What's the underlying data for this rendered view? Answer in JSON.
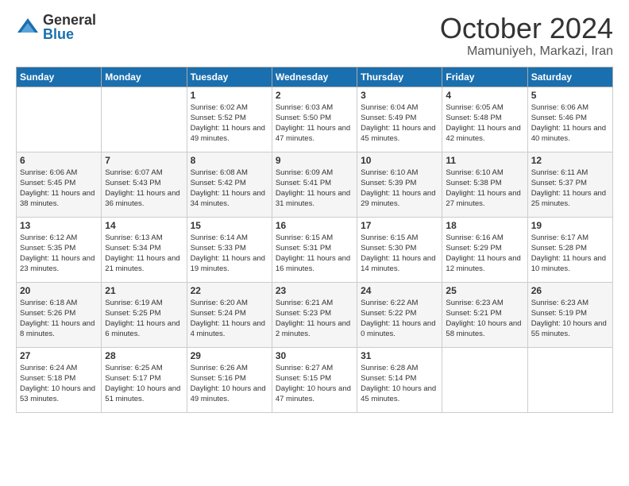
{
  "logo": {
    "general": "General",
    "blue": "Blue"
  },
  "title": {
    "month": "October 2024",
    "location": "Mamuniyeh, Markazi, Iran"
  },
  "headers": [
    "Sunday",
    "Monday",
    "Tuesday",
    "Wednesday",
    "Thursday",
    "Friday",
    "Saturday"
  ],
  "weeks": [
    [
      {
        "day": "",
        "info": ""
      },
      {
        "day": "",
        "info": ""
      },
      {
        "day": "1",
        "sunrise": "6:02 AM",
        "sunset": "5:52 PM",
        "daylight": "11 hours and 49 minutes."
      },
      {
        "day": "2",
        "sunrise": "6:03 AM",
        "sunset": "5:50 PM",
        "daylight": "11 hours and 47 minutes."
      },
      {
        "day": "3",
        "sunrise": "6:04 AM",
        "sunset": "5:49 PM",
        "daylight": "11 hours and 45 minutes."
      },
      {
        "day": "4",
        "sunrise": "6:05 AM",
        "sunset": "5:48 PM",
        "daylight": "11 hours and 42 minutes."
      },
      {
        "day": "5",
        "sunrise": "6:06 AM",
        "sunset": "5:46 PM",
        "daylight": "11 hours and 40 minutes."
      }
    ],
    [
      {
        "day": "6",
        "sunrise": "6:06 AM",
        "sunset": "5:45 PM",
        "daylight": "11 hours and 38 minutes."
      },
      {
        "day": "7",
        "sunrise": "6:07 AM",
        "sunset": "5:43 PM",
        "daylight": "11 hours and 36 minutes."
      },
      {
        "day": "8",
        "sunrise": "6:08 AM",
        "sunset": "5:42 PM",
        "daylight": "11 hours and 34 minutes."
      },
      {
        "day": "9",
        "sunrise": "6:09 AM",
        "sunset": "5:41 PM",
        "daylight": "11 hours and 31 minutes."
      },
      {
        "day": "10",
        "sunrise": "6:10 AM",
        "sunset": "5:39 PM",
        "daylight": "11 hours and 29 minutes."
      },
      {
        "day": "11",
        "sunrise": "6:10 AM",
        "sunset": "5:38 PM",
        "daylight": "11 hours and 27 minutes."
      },
      {
        "day": "12",
        "sunrise": "6:11 AM",
        "sunset": "5:37 PM",
        "daylight": "11 hours and 25 minutes."
      }
    ],
    [
      {
        "day": "13",
        "sunrise": "6:12 AM",
        "sunset": "5:35 PM",
        "daylight": "11 hours and 23 minutes."
      },
      {
        "day": "14",
        "sunrise": "6:13 AM",
        "sunset": "5:34 PM",
        "daylight": "11 hours and 21 minutes."
      },
      {
        "day": "15",
        "sunrise": "6:14 AM",
        "sunset": "5:33 PM",
        "daylight": "11 hours and 19 minutes."
      },
      {
        "day": "16",
        "sunrise": "6:15 AM",
        "sunset": "5:31 PM",
        "daylight": "11 hours and 16 minutes."
      },
      {
        "day": "17",
        "sunrise": "6:15 AM",
        "sunset": "5:30 PM",
        "daylight": "11 hours and 14 minutes."
      },
      {
        "day": "18",
        "sunrise": "6:16 AM",
        "sunset": "5:29 PM",
        "daylight": "11 hours and 12 minutes."
      },
      {
        "day": "19",
        "sunrise": "6:17 AM",
        "sunset": "5:28 PM",
        "daylight": "11 hours and 10 minutes."
      }
    ],
    [
      {
        "day": "20",
        "sunrise": "6:18 AM",
        "sunset": "5:26 PM",
        "daylight": "11 hours and 8 minutes."
      },
      {
        "day": "21",
        "sunrise": "6:19 AM",
        "sunset": "5:25 PM",
        "daylight": "11 hours and 6 minutes."
      },
      {
        "day": "22",
        "sunrise": "6:20 AM",
        "sunset": "5:24 PM",
        "daylight": "11 hours and 4 minutes."
      },
      {
        "day": "23",
        "sunrise": "6:21 AM",
        "sunset": "5:23 PM",
        "daylight": "11 hours and 2 minutes."
      },
      {
        "day": "24",
        "sunrise": "6:22 AM",
        "sunset": "5:22 PM",
        "daylight": "11 hours and 0 minutes."
      },
      {
        "day": "25",
        "sunrise": "6:23 AM",
        "sunset": "5:21 PM",
        "daylight": "10 hours and 58 minutes."
      },
      {
        "day": "26",
        "sunrise": "6:23 AM",
        "sunset": "5:19 PM",
        "daylight": "10 hours and 55 minutes."
      }
    ],
    [
      {
        "day": "27",
        "sunrise": "6:24 AM",
        "sunset": "5:18 PM",
        "daylight": "10 hours and 53 minutes."
      },
      {
        "day": "28",
        "sunrise": "6:25 AM",
        "sunset": "5:17 PM",
        "daylight": "10 hours and 51 minutes."
      },
      {
        "day": "29",
        "sunrise": "6:26 AM",
        "sunset": "5:16 PM",
        "daylight": "10 hours and 49 minutes."
      },
      {
        "day": "30",
        "sunrise": "6:27 AM",
        "sunset": "5:15 PM",
        "daylight": "10 hours and 47 minutes."
      },
      {
        "day": "31",
        "sunrise": "6:28 AM",
        "sunset": "5:14 PM",
        "daylight": "10 hours and 45 minutes."
      },
      {
        "day": "",
        "info": ""
      },
      {
        "day": "",
        "info": ""
      }
    ]
  ]
}
